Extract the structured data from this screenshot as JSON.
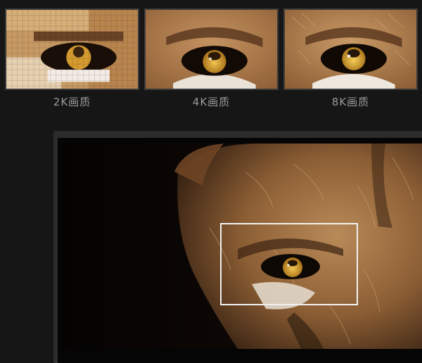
{
  "comparison": {
    "items": [
      {
        "label": "2K画质"
      },
      {
        "label": "4K画质"
      },
      {
        "label": "8K画质"
      }
    ]
  },
  "colors": {
    "background": "#161616",
    "label": "#9a9a9a",
    "highlight_frame": "#f2f2f2",
    "fur": "#b88a55",
    "iris": "#d8a53a"
  }
}
